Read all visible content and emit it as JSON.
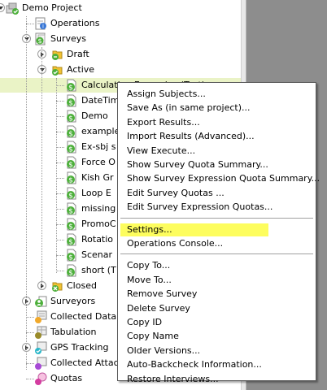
{
  "tree": {
    "items": [
      {
        "label": "Demo Project",
        "icon": "project-icon",
        "indent": 0,
        "expander": "open",
        "selected": false
      },
      {
        "label": "Operations",
        "icon": "operations-icon",
        "indent": 1,
        "expander": "none",
        "selected": false
      },
      {
        "label": "Surveys",
        "icon": "surveys-icon",
        "indent": 1,
        "expander": "open",
        "selected": false
      },
      {
        "label": "Draft",
        "icon": "draft-folder-icon",
        "indent": 2,
        "expander": "closed",
        "selected": false
      },
      {
        "label": "Active",
        "icon": "active-folder-icon",
        "indent": 2,
        "expander": "open",
        "selected": false
      },
      {
        "label": "Calculation Examples (Test)",
        "icon": "survey-icon",
        "indent": 3,
        "expander": "none",
        "selected": true
      },
      {
        "label": "DateTim",
        "icon": "survey-icon",
        "indent": 3,
        "expander": "none",
        "selected": false
      },
      {
        "label": "Demo",
        "icon": "survey-icon",
        "indent": 3,
        "expander": "none",
        "selected": false
      },
      {
        "label": "example",
        "icon": "survey-icon",
        "indent": 3,
        "expander": "none",
        "selected": false
      },
      {
        "label": "Ex-sbj s",
        "icon": "survey-icon",
        "indent": 3,
        "expander": "none",
        "selected": false
      },
      {
        "label": "Force O",
        "icon": "survey-icon",
        "indent": 3,
        "expander": "none",
        "selected": false
      },
      {
        "label": "Kish Gr",
        "icon": "survey-icon",
        "indent": 3,
        "expander": "none",
        "selected": false
      },
      {
        "label": "Loop E",
        "icon": "survey-icon",
        "indent": 3,
        "expander": "none",
        "selected": false
      },
      {
        "label": "missing",
        "icon": "survey-icon",
        "indent": 3,
        "expander": "none",
        "selected": false
      },
      {
        "label": "PromoC",
        "icon": "survey-icon",
        "indent": 3,
        "expander": "none",
        "selected": false
      },
      {
        "label": "Rotatio",
        "icon": "survey-icon",
        "indent": 3,
        "expander": "none",
        "selected": false
      },
      {
        "label": "Scenar",
        "icon": "survey-icon",
        "indent": 3,
        "expander": "none",
        "selected": false
      },
      {
        "label": "short (T",
        "icon": "survey-icon",
        "indent": 3,
        "expander": "none",
        "selected": false
      },
      {
        "label": "Closed",
        "icon": "closed-folder-icon",
        "indent": 2,
        "expander": "closed",
        "selected": false
      },
      {
        "label": "Surveyors",
        "icon": "surveyors-icon",
        "indent": 1,
        "expander": "closed",
        "selected": false
      },
      {
        "label": "Collected Data",
        "icon": "collected-data-icon",
        "indent": 1,
        "expander": "none",
        "selected": false
      },
      {
        "label": "Tabulation",
        "icon": "tabulation-icon",
        "indent": 1,
        "expander": "none",
        "selected": false
      },
      {
        "label": "GPS Tracking",
        "icon": "gps-tracking-icon",
        "indent": 1,
        "expander": "closed",
        "selected": false
      },
      {
        "label": "Collected Attach",
        "icon": "attachments-icon",
        "indent": 1,
        "expander": "none",
        "selected": false
      },
      {
        "label": "Quotas",
        "icon": "quotas-icon",
        "indent": 1,
        "expander": "none",
        "selected": false
      }
    ]
  },
  "context_menu": {
    "highlight_color": "#fdfd5e",
    "groups": [
      [
        "Assign Subjects...",
        "Save As (in same project)...",
        "Export Results...",
        "Import Results (Advanced)...",
        "View Execute...",
        "Show Survey Quota Summary...",
        "Show Survey Expression Quota Summary...",
        "Edit Survey Quotas ...",
        "Edit Survey Expression Quotas..."
      ],
      [
        "Settings...",
        "Operations Console..."
      ],
      [
        "Copy To...",
        "Move To...",
        "Remove Survey",
        "Delete Survey",
        "Copy ID",
        "Copy Name",
        "Older Versions...",
        "Auto-Backcheck Information...",
        "Restore Interviews..."
      ]
    ],
    "highlighted": "Settings..."
  },
  "colors": {
    "selected_row": "#eaf3c6",
    "right_panel": "#8d8d8d",
    "survey_green": "#4caf3a",
    "folder_yellow": "#f1c232"
  }
}
